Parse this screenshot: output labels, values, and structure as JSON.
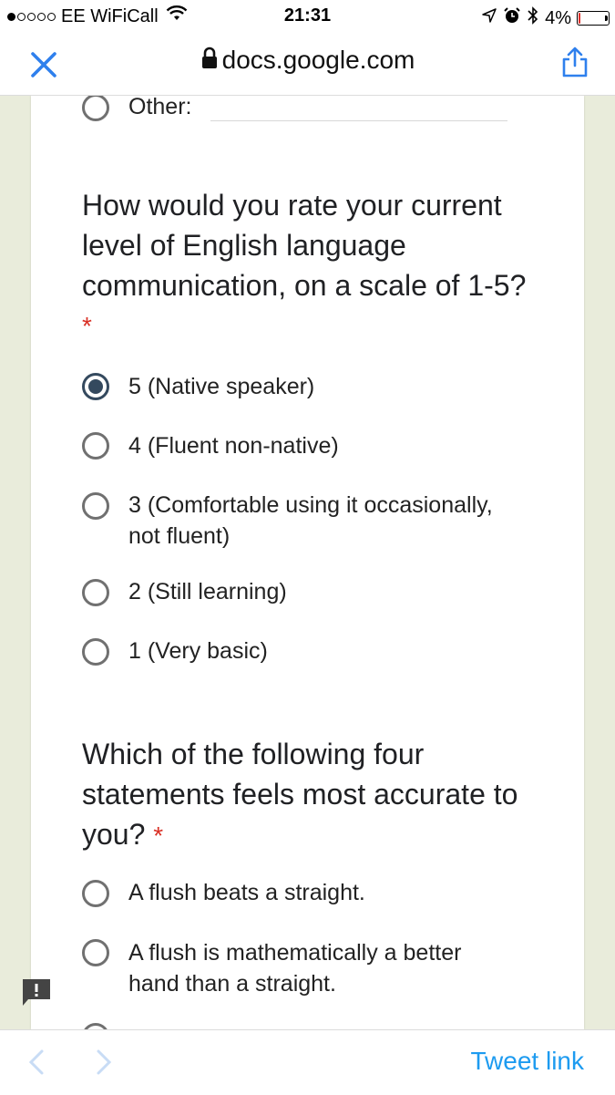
{
  "status_bar": {
    "carrier": "EE WiFiCall",
    "time": "21:31",
    "battery": "4%",
    "signal_dots": [
      true,
      false,
      false,
      false,
      false
    ],
    "battery_level": 0.04
  },
  "address_bar": {
    "url": "docs.google.com"
  },
  "form": {
    "other_label": "Other:",
    "q1": {
      "title": "How would you rate your current level of English language communication, on a scale of 1-5?",
      "required": "*",
      "options": [
        {
          "label": "5 (Native speaker)",
          "checked": true
        },
        {
          "label": "4 (Fluent non-native)",
          "checked": false
        },
        {
          "label": "3 (Comfortable using it occasionally, not fluent)",
          "checked": false
        },
        {
          "label": "2 (Still learning)",
          "checked": false
        },
        {
          "label": "1 (Very basic)",
          "checked": false
        }
      ]
    },
    "q2": {
      "title": "Which of the following four statements feels most accurate to you?",
      "required": "*",
      "options": [
        {
          "label": "A flush beats a straight.",
          "checked": false
        },
        {
          "label": "A flush is mathematically a better hand than a straight.",
          "checked": false
        }
      ]
    }
  },
  "toolbar": {
    "tweet_link": "Tweet link"
  },
  "colors": {
    "accent_radio": "#34495e",
    "required": "#d93025",
    "link": "#1d9bf0",
    "page_bg": "#e9ecdb",
    "ios_blue": "#2f80ed"
  }
}
